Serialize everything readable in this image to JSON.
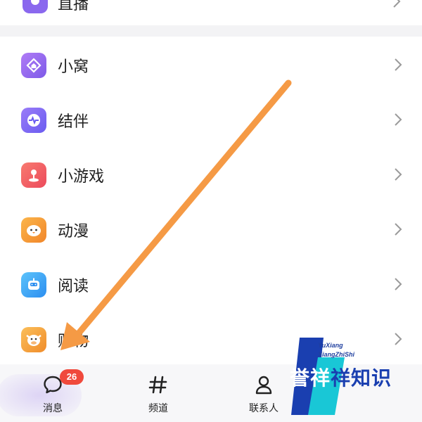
{
  "menu": {
    "partial_top": {
      "label": "直播",
      "icon": "live-icon",
      "color": "#8a68ee"
    },
    "items": [
      {
        "label": "小窝",
        "icon": "home-icon",
        "color": "#9b6af0"
      },
      {
        "label": "结伴",
        "icon": "pulse-icon",
        "color": "#7c6cf2"
      },
      {
        "label": "小游戏",
        "icon": "joystick-icon",
        "color": "#f25b63"
      },
      {
        "label": "动漫",
        "icon": "chick-icon",
        "color": "#f39a2c"
      },
      {
        "label": "阅读",
        "icon": "book-bot-icon",
        "color": "#3aa7f3"
      },
      {
        "label": "购物",
        "icon": "cow-icon",
        "color": "#f4a13a"
      }
    ]
  },
  "bottom_nav": {
    "items": [
      {
        "label": "消息",
        "icon": "chat-bubble-icon",
        "badge": "26"
      },
      {
        "label": "频道",
        "icon": "hash-icon"
      },
      {
        "label": "联系人",
        "icon": "person-icon"
      }
    ]
  },
  "watermark": {
    "line1": "YuXiang",
    "line2": "XiangZhiShi",
    "main_text": "誉祥",
    "main_tail": "祥知识",
    "colors": {
      "cyan": "#19c7d6",
      "blue": "#1a3fb0"
    }
  },
  "annotation": {
    "arrow_color": "#f59a45",
    "arrow_meaning": "pointing to 消息 tab"
  }
}
